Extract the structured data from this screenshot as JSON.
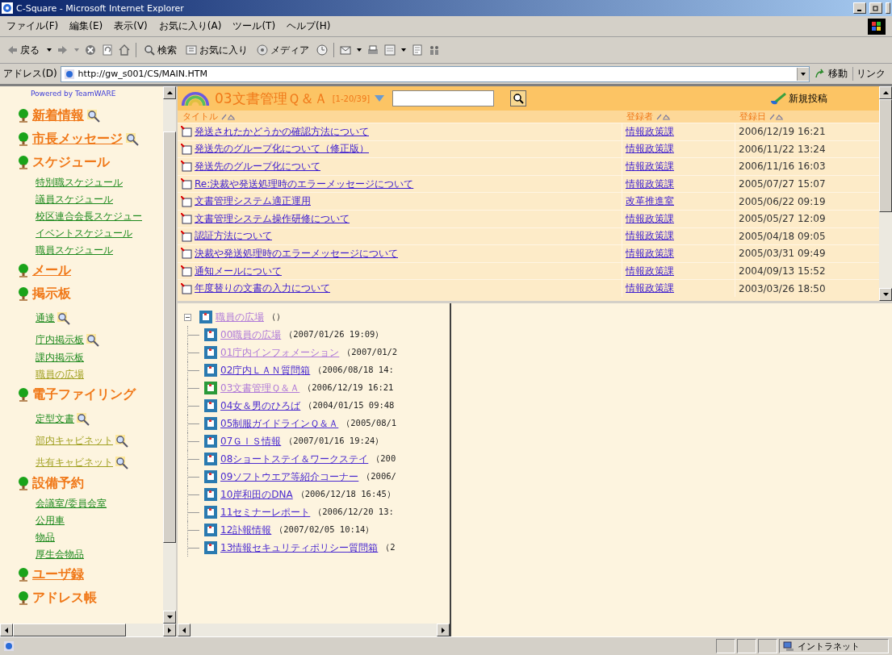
{
  "window": {
    "title": "C-Square - Microsoft Internet Explorer"
  },
  "menu": [
    "ファイル(F)",
    "編集(E)",
    "表示(V)",
    "お気に入り(A)",
    "ツール(T)",
    "ヘルプ(H)"
  ],
  "toolbar": {
    "back": "戻る",
    "search": "検索",
    "favorites": "お気に入り",
    "media": "メディア"
  },
  "address_bar": {
    "label": "アドレス(D)",
    "value": "http://gw_s001/CS/MAIN.HTM",
    "go": "移動",
    "links": "リンク"
  },
  "sidebar": {
    "powered_by": "Powered by TeamWARE",
    "sections": [
      {
        "title": "新着情報",
        "link": true,
        "search": true
      },
      {
        "title": "市長メッセージ",
        "link": true,
        "search": true
      },
      {
        "title": "スケジュール",
        "link": false,
        "search": false,
        "items": [
          {
            "label": "特別職スケジュール",
            "search": false,
            "visited": false
          },
          {
            "label": "議員スケジュール",
            "search": false,
            "visited": false
          },
          {
            "label": "校区連合会長スケジュー",
            "search": false,
            "visited": false
          },
          {
            "label": "イベントスケジュール",
            "search": false,
            "visited": false
          },
          {
            "label": "職員スケジュール",
            "search": false,
            "visited": false
          }
        ]
      },
      {
        "title": "メール",
        "link": true,
        "search": false
      },
      {
        "title": "掲示板",
        "link": false,
        "search": false,
        "items": [
          {
            "label": "通達",
            "search": true,
            "visited": false
          },
          {
            "label": "庁内掲示板",
            "search": true,
            "visited": false
          },
          {
            "label": "課内掲示板",
            "search": false,
            "visited": false
          },
          {
            "label": "職員の広場",
            "search": false,
            "visited": true
          }
        ]
      },
      {
        "title": "電子ファイリング",
        "link": false,
        "search": false,
        "items": [
          {
            "label": "定型文書",
            "search": true,
            "visited": false
          },
          {
            "label": "部内キャビネット",
            "search": true,
            "visited": true
          },
          {
            "label": "共有キャビネット",
            "search": true,
            "visited": true
          }
        ]
      },
      {
        "title": "設備予約",
        "link": false,
        "search": false,
        "items": [
          {
            "label": "会議室/委員会室",
            "search": false,
            "visited": false
          },
          {
            "label": "公用車",
            "search": false,
            "visited": false
          },
          {
            "label": "物品",
            "search": false,
            "visited": false
          },
          {
            "label": "厚生会物品",
            "search": false,
            "visited": false
          }
        ]
      },
      {
        "title": "ユーザ録",
        "link": true,
        "search": false
      },
      {
        "title": "アドレス帳",
        "link": false,
        "search": false
      }
    ]
  },
  "board": {
    "title": "03文書管理Ｑ＆Ａ",
    "range": "[1-20/39]",
    "new_post": "新規投稿",
    "columns": [
      "タイトル",
      "登録者",
      "登録日"
    ],
    "rows": [
      {
        "title": "発送されたかどうかの確認方法について",
        "author": "情報政策課",
        "date": "2006/12/19 16:21"
      },
      {
        "title": "発送先のグループ化について（修正版）",
        "author": "情報政策課",
        "date": "2006/11/22 13:24"
      },
      {
        "title": "発送先のグループ化について",
        "author": "情報政策課",
        "date": "2006/11/16 16:03"
      },
      {
        "title": "Re:決裁や発送処理時のエラーメッセージについて",
        "author": "情報政策課",
        "date": "2005/07/27 15:07"
      },
      {
        "title": "文書管理システム適正運用",
        "author": "改革推進室",
        "date": "2005/06/22 09:19"
      },
      {
        "title": "文書管理システム操作研修について",
        "author": "情報政策課",
        "date": "2005/05/27 12:09"
      },
      {
        "title": "認証方法について",
        "author": "情報政策課",
        "date": "2005/04/18 09:05"
      },
      {
        "title": "決裁や発送処理時のエラーメッセージについて",
        "author": "情報政策課",
        "date": "2005/03/31 09:49"
      },
      {
        "title": "通知メールについて",
        "author": "情報政策課",
        "date": "2004/09/13 15:52"
      },
      {
        "title": "年度替りの文書の入力について",
        "author": "情報政策課",
        "date": "2003/03/26 18:50"
      }
    ]
  },
  "tree": {
    "label": "職員の広場",
    "note": "（）",
    "visited": true,
    "expanded": true,
    "children": [
      {
        "label": "00職員の広場",
        "note": "（2007/01/26 19:09）",
        "visited": true,
        "current": false
      },
      {
        "label": "01庁内インフォメーション",
        "note": "（2007/01/2",
        "visited": true,
        "current": false
      },
      {
        "label": "02庁内ＬＡＮ質問箱",
        "note": "（2006/08/18 14:",
        "visited": false,
        "current": false
      },
      {
        "label": "03文書管理Ｑ＆Ａ",
        "note": "（2006/12/19 16:21",
        "visited": true,
        "current": true
      },
      {
        "label": "04女＆男のひろば",
        "note": "（2004/01/15 09:48",
        "visited": false,
        "current": false
      },
      {
        "label": "05制服ガイドラインＱ＆Ａ",
        "note": "（2005/08/1",
        "visited": false,
        "current": false
      },
      {
        "label": "07ＧＩＳ情報",
        "note": "（2007/01/16 19:24）",
        "visited": false,
        "current": false
      },
      {
        "label": "08ショートステイ＆ワークステイ",
        "note": "（200",
        "visited": false,
        "current": false
      },
      {
        "label": "09ソフトウエア等紹介コーナー",
        "note": "（2006/",
        "visited": false,
        "current": false
      },
      {
        "label": "10岸和田のDNA",
        "note": "（2006/12/18 16:45）",
        "visited": false,
        "current": false
      },
      {
        "label": "11セミナーレポート",
        "note": "（2006/12/20 13:",
        "visited": false,
        "current": false
      },
      {
        "label": "12訃報情報",
        "note": "（2007/02/05 10:14）",
        "visited": false,
        "current": false
      },
      {
        "label": "13情報セキュリティポリシー質問箱",
        "note": "（2",
        "visited": false,
        "current": false
      }
    ]
  },
  "status_bar": {
    "zone": "イントラネット"
  }
}
